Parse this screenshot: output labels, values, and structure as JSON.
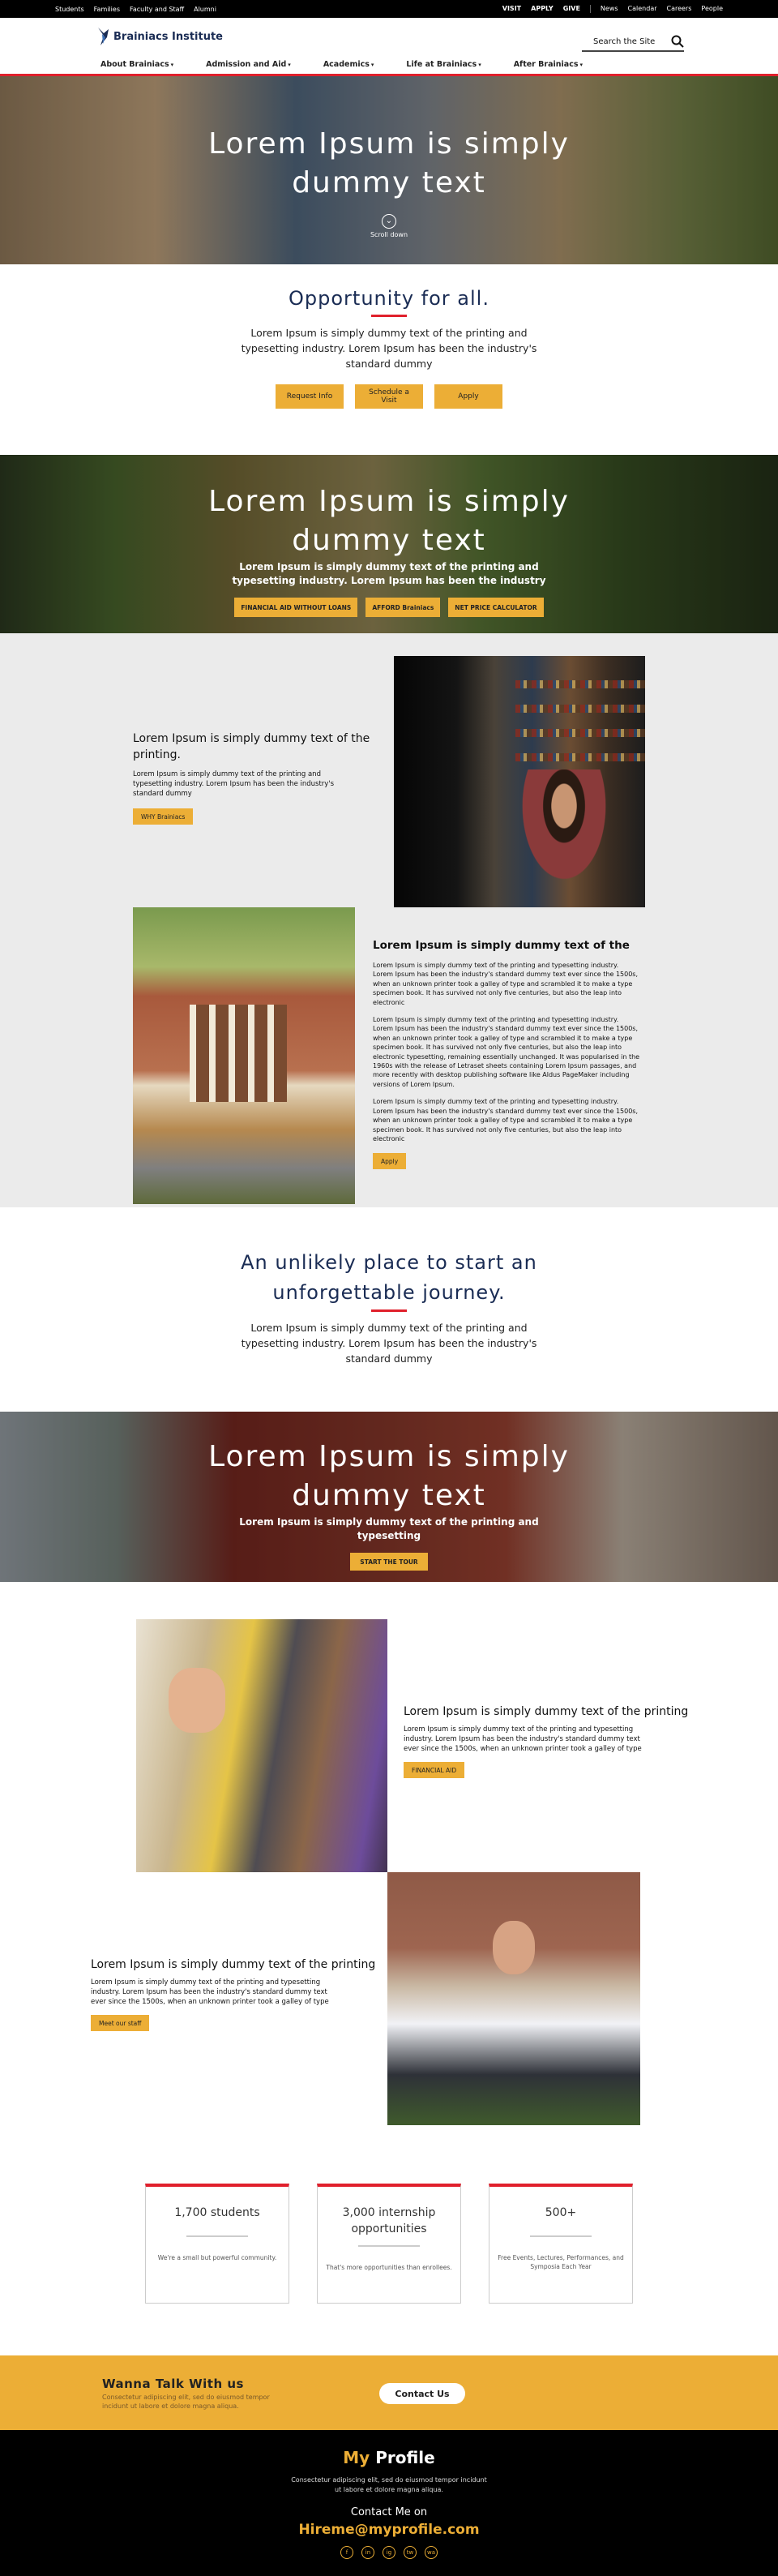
{
  "topbar": {
    "left": [
      "Students",
      "Families",
      "Faculty and Staff",
      "Alumni"
    ],
    "right_bold": [
      "VISIT",
      "APPLY",
      "GIVE"
    ],
    "right": [
      "News",
      "Calendar",
      "Careers",
      "People"
    ]
  },
  "header": {
    "logo_text": "Brainiacs Institute",
    "search_placeholder": "Search the Site",
    "nav": [
      "About Brainiacs",
      "Admission and Aid",
      "Academics",
      "Life at Brainiacs",
      "After Brainiacs"
    ]
  },
  "hero1": {
    "title_line1": "Lorem Ipsum is simply",
    "title_line2": "dummy text",
    "scroll": "Scroll down"
  },
  "intro": {
    "title": "Opportunity for all.",
    "text": "Lorem Ipsum is simply dummy text of the printing and typesetting industry. Lorem Ipsum has been the industry's standard dummy",
    "buttons": [
      "Request Info",
      "Schedule a Visit",
      "Apply"
    ]
  },
  "hero2": {
    "title_line1": "Lorem Ipsum is simply",
    "title_line2": "dummy text",
    "text": "Lorem Ipsum is simply dummy text of the printing and typesetting industry. Lorem Ipsum has been the industry",
    "buttons": [
      "FINANCIAL AID WITHOUT LOANS",
      "AFFORD Brainiacs",
      "NET PRICE CALCULATOR"
    ]
  },
  "feature1": {
    "title": "Lorem Ipsum is simply dummy text of the printing.",
    "text": "Lorem Ipsum is simply dummy text of the printing and typesetting industry. Lorem Ipsum has been the industry's standard dummy",
    "button": "WHY Brainiacs"
  },
  "feature2": {
    "title": "Lorem Ipsum is simply dummy text of the",
    "p1": "Lorem Ipsum is simply dummy text of the printing and typesetting industry. Lorem Ipsum has been the industry's standard dummy text ever since the 1500s, when an unknown printer took a galley of type and scrambled it to make a type specimen book. It has survived not only five centuries, but also the leap into electronic",
    "p2": "Lorem Ipsum is simply dummy text of the printing and typesetting industry. Lorem Ipsum has been the industry's standard dummy text ever since the 1500s, when an unknown printer took a galley of type and scrambled it to make a type specimen book. It has survived not only five centuries, but also the leap into electronic typesetting, remaining essentially unchanged. It was popularised in the 1960s with the release of Letraset sheets containing Lorem Ipsum passages, and more recently with desktop publishing software like Aldus PageMaker including versions of Lorem Ipsum.",
    "p3": "Lorem Ipsum is simply dummy text of the printing and typesetting industry. Lorem Ipsum has been the industry's standard dummy text ever since the 1500s, when an unknown printer took a galley of type and scrambled it to make a type specimen book. It has survived not only five centuries, but also the leap into electronic",
    "button": "Apply"
  },
  "journey": {
    "title_line1": "An unlikely place to start an",
    "title_line2": "unforgettable journey.",
    "text": "Lorem Ipsum is simply dummy text of the printing and typesetting industry. Lorem Ipsum has been the industry's standard dummy"
  },
  "hero3": {
    "title_line1": "Lorem Ipsum is simply",
    "title_line2": "dummy text",
    "text": "Lorem Ipsum is simply dummy text of the printing and typesetting",
    "button": "START THE TOUR"
  },
  "feature3": {
    "title": "Lorem Ipsum is simply dummy text of the printing",
    "text": "Lorem Ipsum is simply dummy text of the printing and typesetting industry. Lorem Ipsum has been the industry's standard dummy text ever since the 1500s, when an unknown printer took a galley of type",
    "button": "FINANCIAL AID"
  },
  "feature4": {
    "title": "Lorem Ipsum is simply dummy text of the printing",
    "text": "Lorem Ipsum is simply dummy text of the printing and typesetting industry. Lorem Ipsum has been the industry's standard dummy text ever since the 1500s, when an unknown printer took a galley of type",
    "button": "Meet our staff"
  },
  "stats": [
    {
      "big": "1,700 students",
      "small": "We're a small but powerful community."
    },
    {
      "big": "3,000 internship opportunities",
      "small": "That's more opportunities than enrollees."
    },
    {
      "big": "500+",
      "small": "Free Events, Lectures, Performances, and Symposia Each Year"
    }
  ],
  "cta": {
    "title": "Wanna Talk With us",
    "text": "Consectetur adipiscing elit, sed do eiusmod tempor incidunt ut labore et dolore magna aliqua.",
    "button": "Contact Us"
  },
  "footer": {
    "my": "My",
    "profile": "Profile",
    "tagline": "Consectetur adipiscing elit, sed do eiusmod tempor incidunt ut labore et dolore magna aliqua.",
    "contact_label": "Contact Me on",
    "email": "Hireme@myprofile.com",
    "social": [
      "f",
      "in",
      "ig",
      "tw",
      "wa"
    ]
  },
  "colors": {
    "accent": "#ecae36",
    "red": "#e0202c",
    "navy": "#1a2c54"
  }
}
